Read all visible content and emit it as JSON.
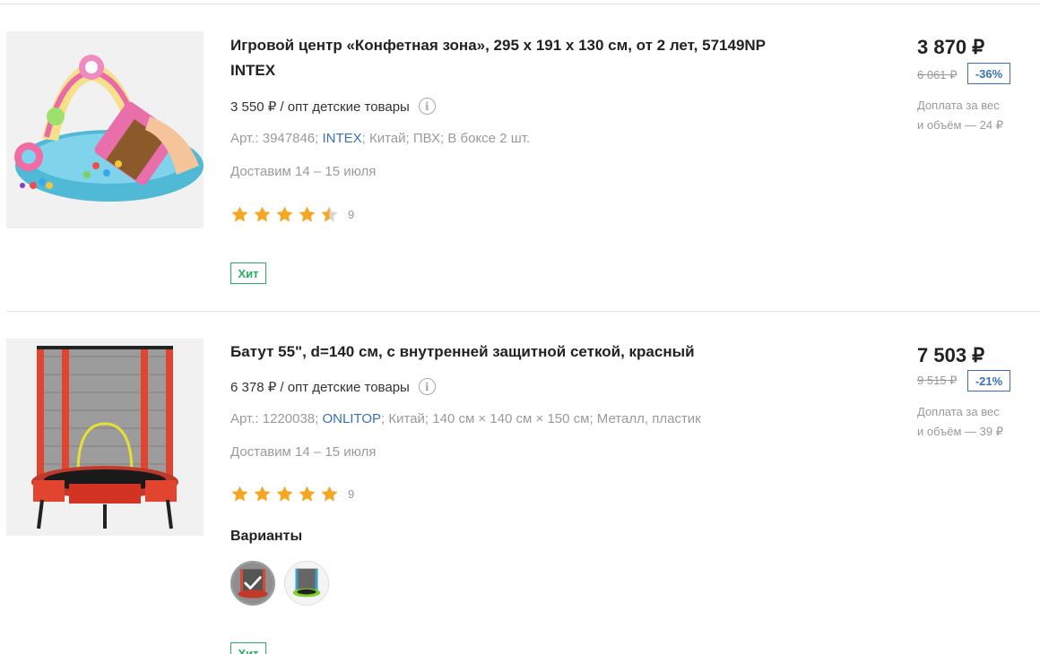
{
  "products": [
    {
      "title_line1": "Игровой центр «Конфетная зона», 295 x 191 x 130 см, от 2 лет, 57149NP",
      "title_line2": "INTEX",
      "wholesale": "3 550 ₽ / опт детские товары",
      "meta_prefix": "Арт.: 3947846;",
      "brand": "INTEX",
      "meta_suffix": "; Китай;  ПВХ;  В боксе 2 шт.",
      "delivery": "Доставим 14 – 15 июля",
      "rating": 4.5,
      "reviews": "9",
      "badge": "Хит",
      "price": "3 870 ₽",
      "old_price": "6 061 ₽",
      "discount": "-36%",
      "surcharge_line1": "Доплата за вес",
      "surcharge_line2": "и объём — 24 ₽",
      "image": "inflatable-candy-pool-image"
    },
    {
      "title_line1": "Батут 55\", d=140 см, с внутренней защитной сеткой, красный",
      "wholesale": "6 378 ₽ / опт детские товары",
      "meta_prefix": "Арт.: 1220038;",
      "brand": "ONLITOP",
      "meta_suffix": "; Китай;  140 см × 140 см × 150 см;  Металл, пластик",
      "delivery": "Доставим 14 – 15 июля",
      "rating": 5,
      "reviews": "9",
      "variants_label": "Варианты",
      "badge": "Хит",
      "price": "7 503 ₽",
      "old_price": "9 515 ₽",
      "discount": "-21%",
      "surcharge_line1": "Доплата за вес",
      "surcharge_line2": "и объём — 39 ₽",
      "image": "red-trampoline-image"
    }
  ],
  "colors": {
    "star": "#f5a623",
    "link": "#3b6fb6",
    "hit_badge": "#27ae60",
    "discount_badge": "#3b6fb6"
  }
}
